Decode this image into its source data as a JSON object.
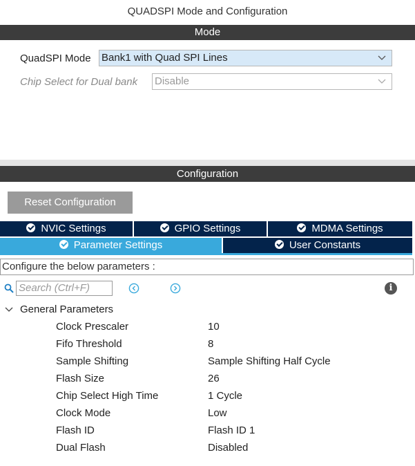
{
  "header": {
    "title": "QUADSPI Mode and Configuration"
  },
  "mode": {
    "bar_label": "Mode",
    "quadspi_mode_label": "QuadSPI Mode",
    "quadspi_mode_value": "Bank1 with Quad SPI Lines",
    "chip_select_label": "Chip Select for Dual bank",
    "chip_select_value": "Disable"
  },
  "configuration": {
    "bar_label": "Configuration",
    "reset_label": "Reset Configuration",
    "tabs": [
      {
        "label": "NVIC Settings"
      },
      {
        "label": "GPIO Settings"
      },
      {
        "label": "MDMA Settings"
      },
      {
        "label": "Parameter Settings"
      },
      {
        "label": "User Constants"
      }
    ],
    "description": "Configure the below parameters :",
    "search_placeholder": "Search (Ctrl+F)",
    "info_glyph": "i",
    "group_label": "General Parameters",
    "params": [
      {
        "name": "Clock Prescaler",
        "value": "10"
      },
      {
        "name": "Fifo Threshold",
        "value": "8"
      },
      {
        "name": "Sample Shifting",
        "value": "Sample Shifting Half Cycle"
      },
      {
        "name": "Flash Size",
        "value": "26"
      },
      {
        "name": "Chip Select High Time",
        "value": "1 Cycle"
      },
      {
        "name": "Clock Mode",
        "value": "Low"
      },
      {
        "name": "Flash ID",
        "value": "Flash ID 1"
      },
      {
        "name": "Dual Flash",
        "value": "Disabled"
      }
    ]
  },
  "colors": {
    "bar_dark": "#3c3c3c",
    "tab_navy": "#03234b",
    "tab_active": "#39a9dc",
    "select_active": "#d7e9f8",
    "button_grey": "#9a9a9a"
  }
}
